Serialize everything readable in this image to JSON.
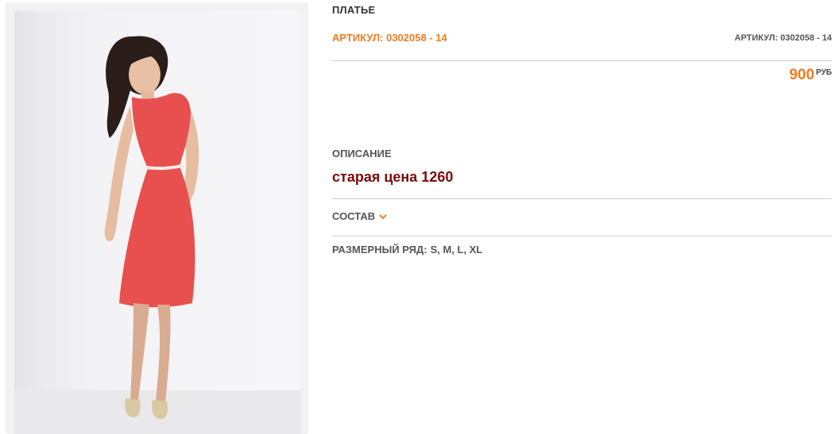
{
  "product": {
    "title": "ПЛАТЬЕ",
    "article_left": "АРТИКУЛ: 0302058 - 14",
    "article_right": "АРТИКУЛ: 0302058 - 14",
    "price_value": "900",
    "price_currency": "РУБ"
  },
  "description": {
    "label": "ОПИСАНИЕ",
    "old_price": "старая цена 1260"
  },
  "composition": {
    "label": "СОСТАВ",
    "icon": "chevron-down-icon"
  },
  "sizes": {
    "label": "РАЗМЕРНЫЙ РЯД:",
    "values": "S, M, L, XL"
  },
  "colors": {
    "accent": "#f07c1e",
    "old_price": "#7a0b0b",
    "dress": "#e8504f"
  }
}
